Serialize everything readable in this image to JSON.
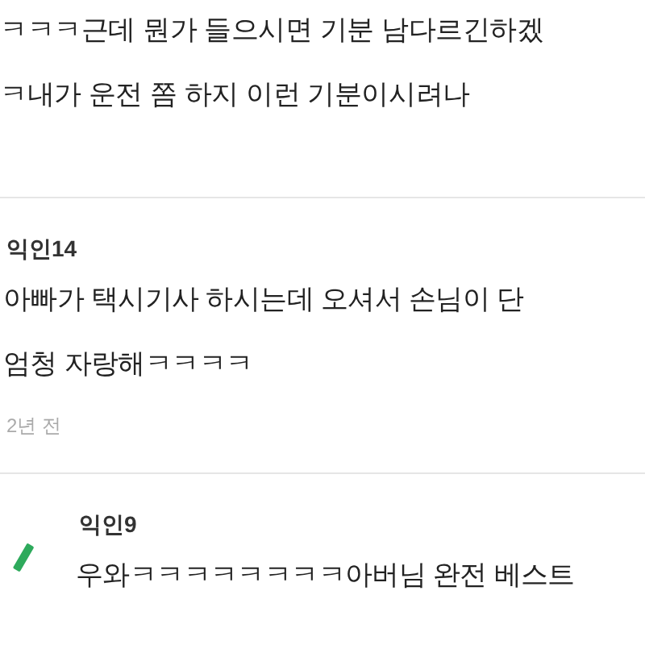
{
  "post_lines": [
    "ㅋㅋㅋ근데 뭔가 들으시면 기분 남다르긴하겠",
    "ㅋ내가 운전 쫌 하지 이런 기분이시려나"
  ],
  "comments": [
    {
      "author": "익인14",
      "lines": [
        "아빠가 택시기사 하시는데 오셔서 손님이 단",
        "엄청 자랑해ㅋㅋㅋㅋ"
      ],
      "time": "2년 전",
      "kind": "comment"
    },
    {
      "author": "익인9",
      "lines": [
        "우와ㅋㅋㅋㅋㅋㅋㅋㅋ아버님 완전 베스트"
      ],
      "kind": "reply"
    }
  ]
}
